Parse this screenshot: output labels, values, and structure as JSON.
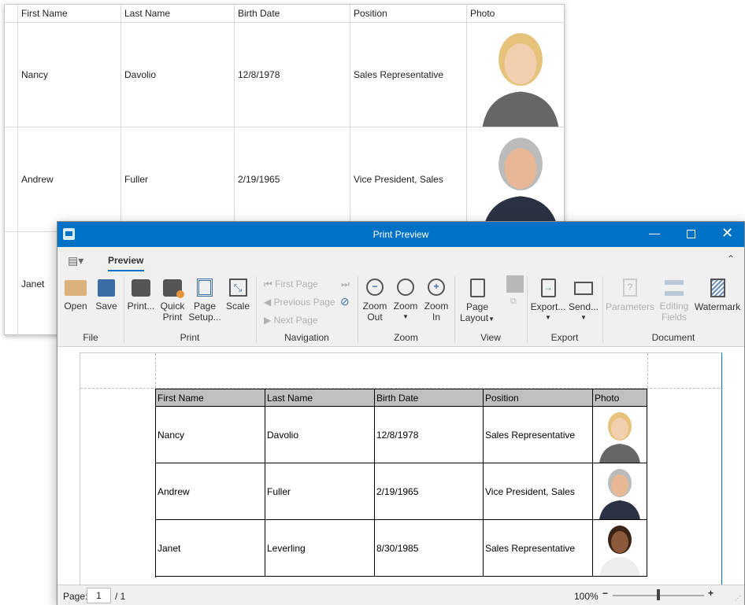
{
  "grid": {
    "columns": [
      "First Name",
      "Last Name",
      "Birth Date",
      "Position",
      "Photo"
    ],
    "rows": [
      [
        "Nancy",
        "Davolio",
        "12/8/1978",
        "Sales Representative"
      ],
      [
        "Andrew",
        "Fuller",
        "2/19/1965",
        "Vice President, Sales"
      ],
      [
        "Janet",
        "Leverling",
        "8/30/1985",
        "Sales Representative"
      ]
    ]
  },
  "window": {
    "title": "Print Preview",
    "tab": "Preview"
  },
  "ribbon": {
    "file": {
      "label": "File",
      "open": "Open",
      "save": "Save"
    },
    "print": {
      "label": "Print",
      "print": "Print...",
      "quick1": "Quick",
      "quick2": "Print",
      "setup1": "Page",
      "setup2": "Setup...",
      "scale": "Scale"
    },
    "navigation": {
      "label": "Navigation",
      "first": "First Page",
      "prev": "Previous Page",
      "next": "Next Page"
    },
    "zoom": {
      "label": "Zoom",
      "out1": "Zoom",
      "out2": "Out",
      "zoom": "Zoom",
      "in1": "Zoom",
      "in2": "In"
    },
    "view": {
      "label": "View",
      "layout1": "Page",
      "layout2": "Layout"
    },
    "export": {
      "label": "Export",
      "export": "Export...",
      "send": "Send..."
    },
    "document": {
      "label": "Document",
      "parameters": "Parameters",
      "edit1": "Editing",
      "edit2": "Fields",
      "watermark": "Watermark"
    }
  },
  "status": {
    "page_label": "Page:",
    "page": "1",
    "total": "/ 1",
    "zoom": "100%",
    "zoom_level_percent": 100
  },
  "colors": {
    "accent": "#0072c6"
  }
}
